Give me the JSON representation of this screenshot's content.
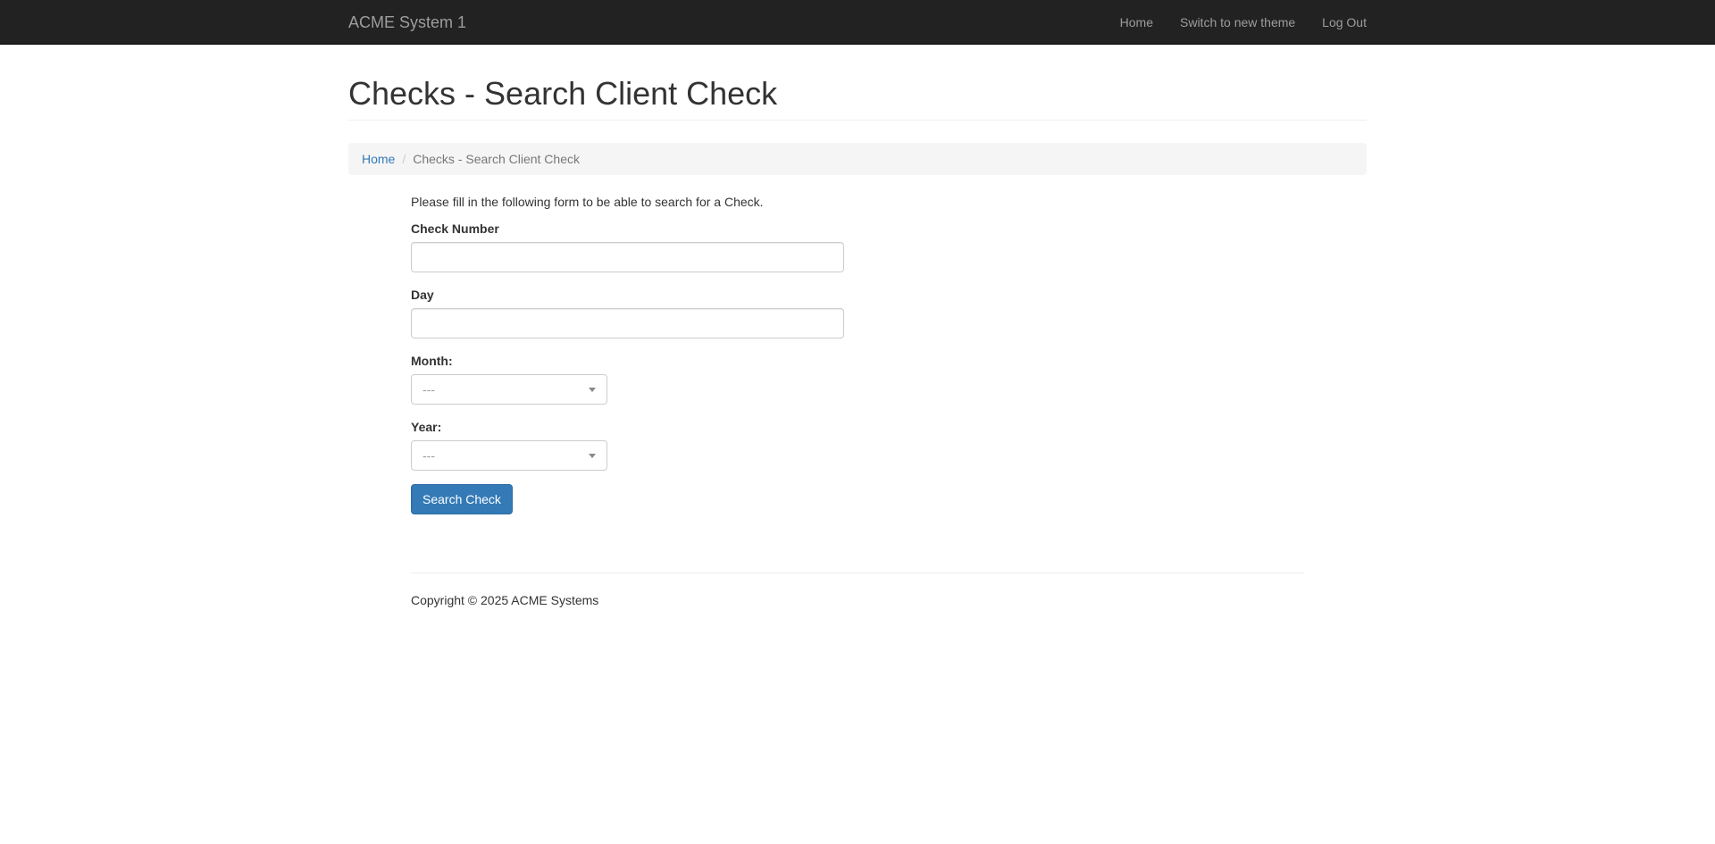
{
  "navbar": {
    "brand": "ACME System 1",
    "links": [
      "Home",
      "Switch to new theme",
      "Log Out"
    ]
  },
  "page": {
    "title": "Checks - Search Client Check"
  },
  "breadcrumb": {
    "home": "Home",
    "separator": "/",
    "current": "Checks - Search Client Check"
  },
  "form": {
    "intro": "Please fill in the following form to be able to search for a Check.",
    "check_number_label": "Check Number",
    "check_number_value": "",
    "day_label": "Day",
    "day_value": "",
    "month_label": "Month:",
    "month_selected": "---",
    "year_label": "Year:",
    "year_selected": "---",
    "submit_label": "Search Check"
  },
  "footer": {
    "copyright": "Copyright © 2025 ACME Systems"
  },
  "colors": {
    "navbar_bg": "#222222",
    "link": "#337ab7",
    "primary_button": "#337ab7"
  }
}
